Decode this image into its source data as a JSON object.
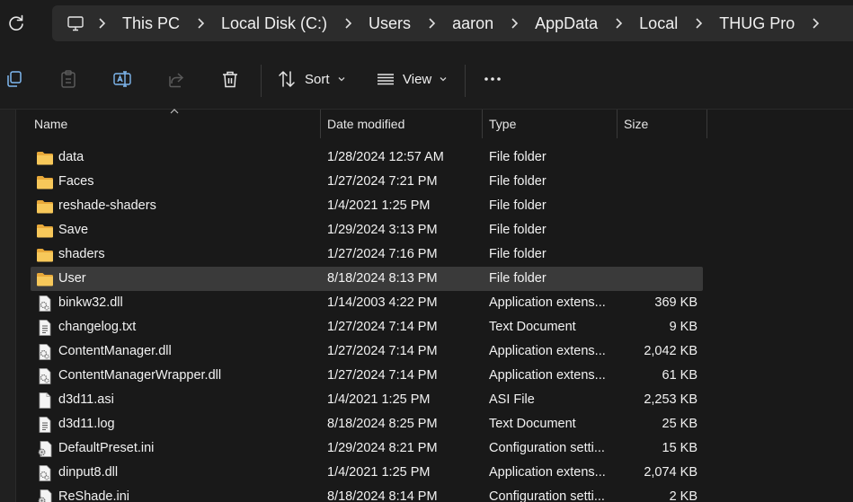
{
  "address": {
    "crumbs": [
      "This PC",
      "Local Disk (C:)",
      "Users",
      "aaron",
      "AppData",
      "Local",
      "THUG Pro"
    ]
  },
  "toolbar": {
    "sort_label": "Sort",
    "view_label": "View"
  },
  "columns": {
    "name": "Name",
    "date": "Date modified",
    "type": "Type",
    "size": "Size"
  },
  "files": [
    {
      "name": "data",
      "date": "1/28/2024 12:57 AM",
      "type": "File folder",
      "size": "",
      "icon": "folder-icon"
    },
    {
      "name": "Faces",
      "date": "1/27/2024 7:21 PM",
      "type": "File folder",
      "size": "",
      "icon": "folder-icon"
    },
    {
      "name": "reshade-shaders",
      "date": "1/4/2021 1:25 PM",
      "type": "File folder",
      "size": "",
      "icon": "folder-icon"
    },
    {
      "name": "Save",
      "date": "1/29/2024 3:13 PM",
      "type": "File folder",
      "size": "",
      "icon": "folder-icon"
    },
    {
      "name": "shaders",
      "date": "1/27/2024 7:16 PM",
      "type": "File folder",
      "size": "",
      "icon": "folder-icon"
    },
    {
      "name": "User",
      "date": "8/18/2024 8:13 PM",
      "type": "File folder",
      "size": "",
      "icon": "folder-icon",
      "selected": true
    },
    {
      "name": "binkw32.dll",
      "date": "1/14/2003 4:22 PM",
      "type": "Application extens...",
      "size": "369 KB",
      "icon": "dll-file-icon"
    },
    {
      "name": "changelog.txt",
      "date": "1/27/2024 7:14 PM",
      "type": "Text Document",
      "size": "9 KB",
      "icon": "text-file-icon"
    },
    {
      "name": "ContentManager.dll",
      "date": "1/27/2024 7:14 PM",
      "type": "Application extens...",
      "size": "2,042 KB",
      "icon": "dll-file-icon"
    },
    {
      "name": "ContentManagerWrapper.dll",
      "date": "1/27/2024 7:14 PM",
      "type": "Application extens...",
      "size": "61 KB",
      "icon": "dll-file-icon"
    },
    {
      "name": "d3d11.asi",
      "date": "1/4/2021 1:25 PM",
      "type": "ASI File",
      "size": "2,253 KB",
      "icon": "blank-file-icon"
    },
    {
      "name": "d3d11.log",
      "date": "8/18/2024 8:25 PM",
      "type": "Text Document",
      "size": "25 KB",
      "icon": "text-file-icon"
    },
    {
      "name": "DefaultPreset.ini",
      "date": "1/29/2024 8:21 PM",
      "type": "Configuration setti...",
      "size": "15 KB",
      "icon": "config-file-icon"
    },
    {
      "name": "dinput8.dll",
      "date": "1/4/2021 1:25 PM",
      "type": "Application extens...",
      "size": "2,074 KB",
      "icon": "dll-file-icon"
    },
    {
      "name": "ReShade.ini",
      "date": "8/18/2024 8:14 PM",
      "type": "Configuration setti...",
      "size": "2 KB",
      "icon": "config-file-icon"
    }
  ],
  "colors": {
    "background": "#191919",
    "folder": "#f2c14e",
    "selected_row": "#3a3a3a",
    "text": "#f2f2f2"
  }
}
